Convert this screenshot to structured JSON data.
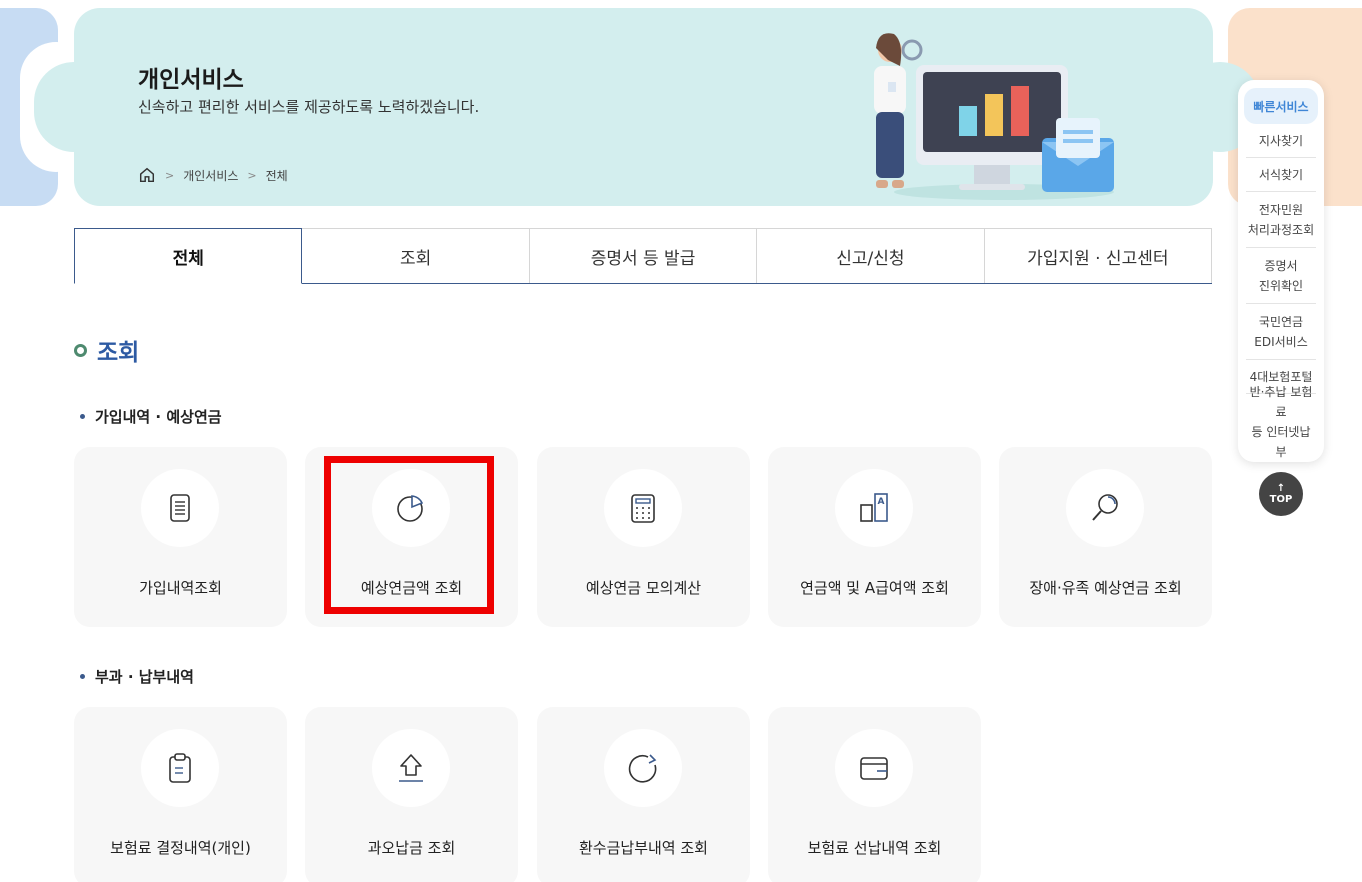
{
  "banner": {
    "title": "개인서비스",
    "subtitle": "신속하고 편리한 서비스를 제공하도록 노력하겠습니다.",
    "breadcrumb": [
      "개인서비스",
      "전체"
    ]
  },
  "tabs": [
    "전체",
    "조회",
    "증명서 등 발급",
    "신고/신청",
    "가입지원 · 신고센터"
  ],
  "section": {
    "title": "조회",
    "groups": [
      {
        "title": "가입내역 · 예상연금",
        "items": [
          {
            "label": "가입내역조회",
            "icon": "document-icon"
          },
          {
            "label": "예상연금액 조회",
            "icon": "pie-chart-icon"
          },
          {
            "label": "예상연금 모의계산",
            "icon": "calculator-icon"
          },
          {
            "label": "연금액 및 A급여액 조회",
            "icon": "compare-icon"
          },
          {
            "label": "장애·유족 예상연금 조회",
            "icon": "magnifier-icon"
          }
        ]
      },
      {
        "title": "부과 · 납부내역",
        "items": [
          {
            "label": "보험료 결정내역(개인)",
            "icon": "clipboard-icon"
          },
          {
            "label": "과오납금 조회",
            "icon": "upload-icon"
          },
          {
            "label": "환수금납부내역 조회",
            "icon": "refresh-icon"
          },
          {
            "label": "보험료 선납내역 조회",
            "icon": "wallet-icon"
          }
        ]
      }
    ]
  },
  "quick_menu": {
    "title": "빠른서비스",
    "items": [
      {
        "l1": "지사찾기",
        "l2": ""
      },
      {
        "l1": "서식찾기",
        "l2": ""
      },
      {
        "l1": "전자민원",
        "l2": "처리과정조회"
      },
      {
        "l1": "증명서",
        "l2": "진위확인"
      },
      {
        "l1": "국민연금",
        "l2": "EDI서비스"
      },
      {
        "l1": "4대보험포털",
        "l2": ""
      },
      {
        "l1": "반·추납 보험료",
        "l2": "등 인터넷납부"
      }
    ],
    "top_label": "TOP"
  },
  "colors": {
    "accent": "#2d5aa3",
    "banner_bg": "#d3eeee",
    "highlight": "#ee0000"
  }
}
